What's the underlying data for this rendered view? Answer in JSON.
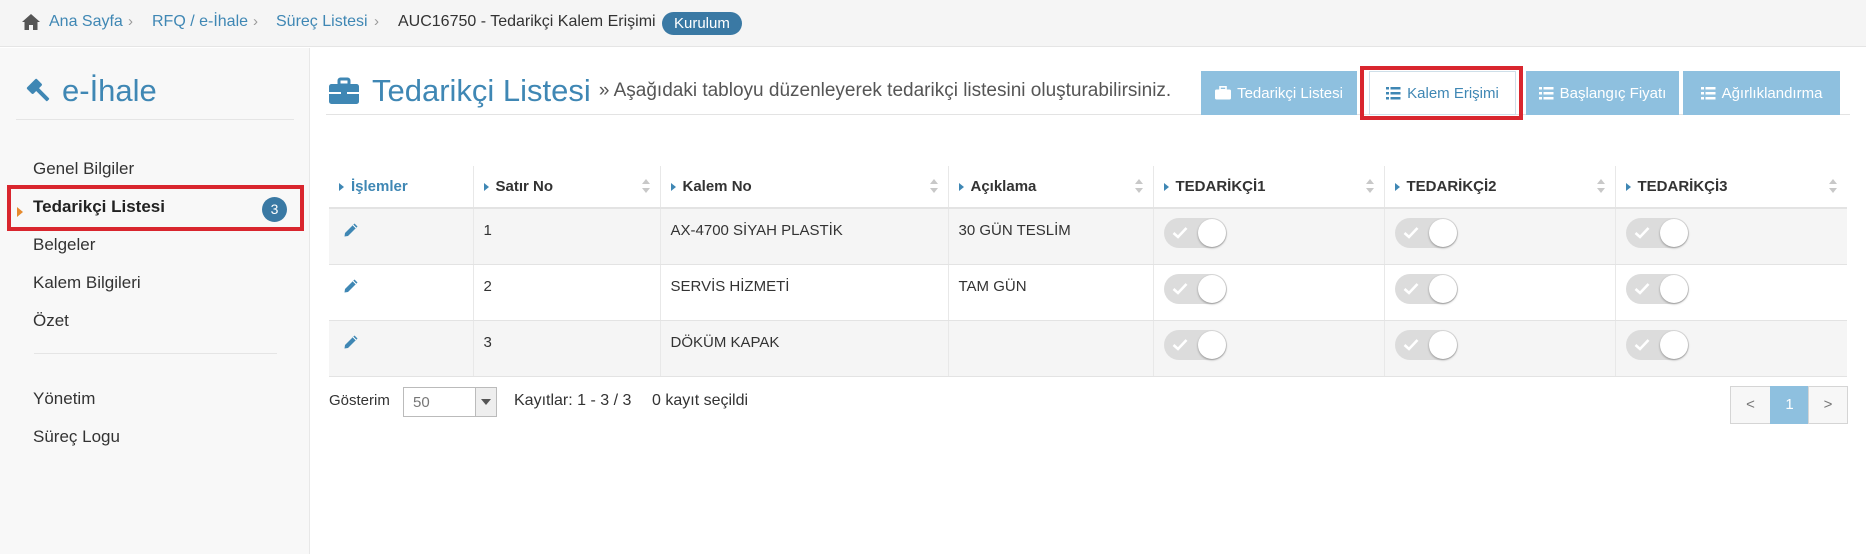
{
  "breadcrumb": {
    "items": [
      "Ana Sayfa",
      "RFQ / e-İhale",
      "Süreç Listesi",
      "AUC16750 - Tedarikçi Kalem Erişimi"
    ],
    "badge": "Kurulum"
  },
  "sidebar": {
    "logo": "e-İhale",
    "items": [
      "Genel Bilgiler",
      "Tedarikçi Listesi",
      "Belgeler",
      "Kalem Bilgileri",
      "Özet",
      "Yönetim",
      "Süreç Logu"
    ],
    "active_count": "3"
  },
  "header": {
    "title": "Tedarikçi Listesi",
    "subtitle": "» Aşağıdaki tabloyu düzenleyerek tedarikçi listesini oluşturabilirsiniz.",
    "tabs": [
      "Tedarikçi Listesi",
      "Kalem Erişimi",
      "Başlangıç Fiyatı",
      "Ağırlıklandırma"
    ]
  },
  "table": {
    "columns": [
      "İşlemler",
      "Satır No",
      "Kalem No",
      "Açıklama",
      "TEDARİKÇİ1",
      "TEDARİKÇİ2",
      "TEDARİKÇİ3"
    ],
    "rows": [
      {
        "satir": "1",
        "kalem": "AX-4700 SİYAH PLASTİK",
        "aciklama": "30 GÜN TESLİM"
      },
      {
        "satir": "2",
        "kalem": "SERVİS HİZMETİ",
        "aciklama": "TAM GÜN"
      },
      {
        "satir": "3",
        "kalem": "DÖKÜM KAPAK",
        "aciklama": ""
      }
    ]
  },
  "footer": {
    "show_label": "Gösterim",
    "page_size": "50",
    "records": "Kayıtlar: 1 - 3 / 3",
    "selected": "0 kayıt seçildi",
    "prev": "<",
    "page": "1",
    "next": ">"
  },
  "colors": {
    "accent": "#3f87b4",
    "tab_bg": "#8ec0df",
    "highlight": "#d9262e",
    "active_arrow": "#e68a2e"
  }
}
